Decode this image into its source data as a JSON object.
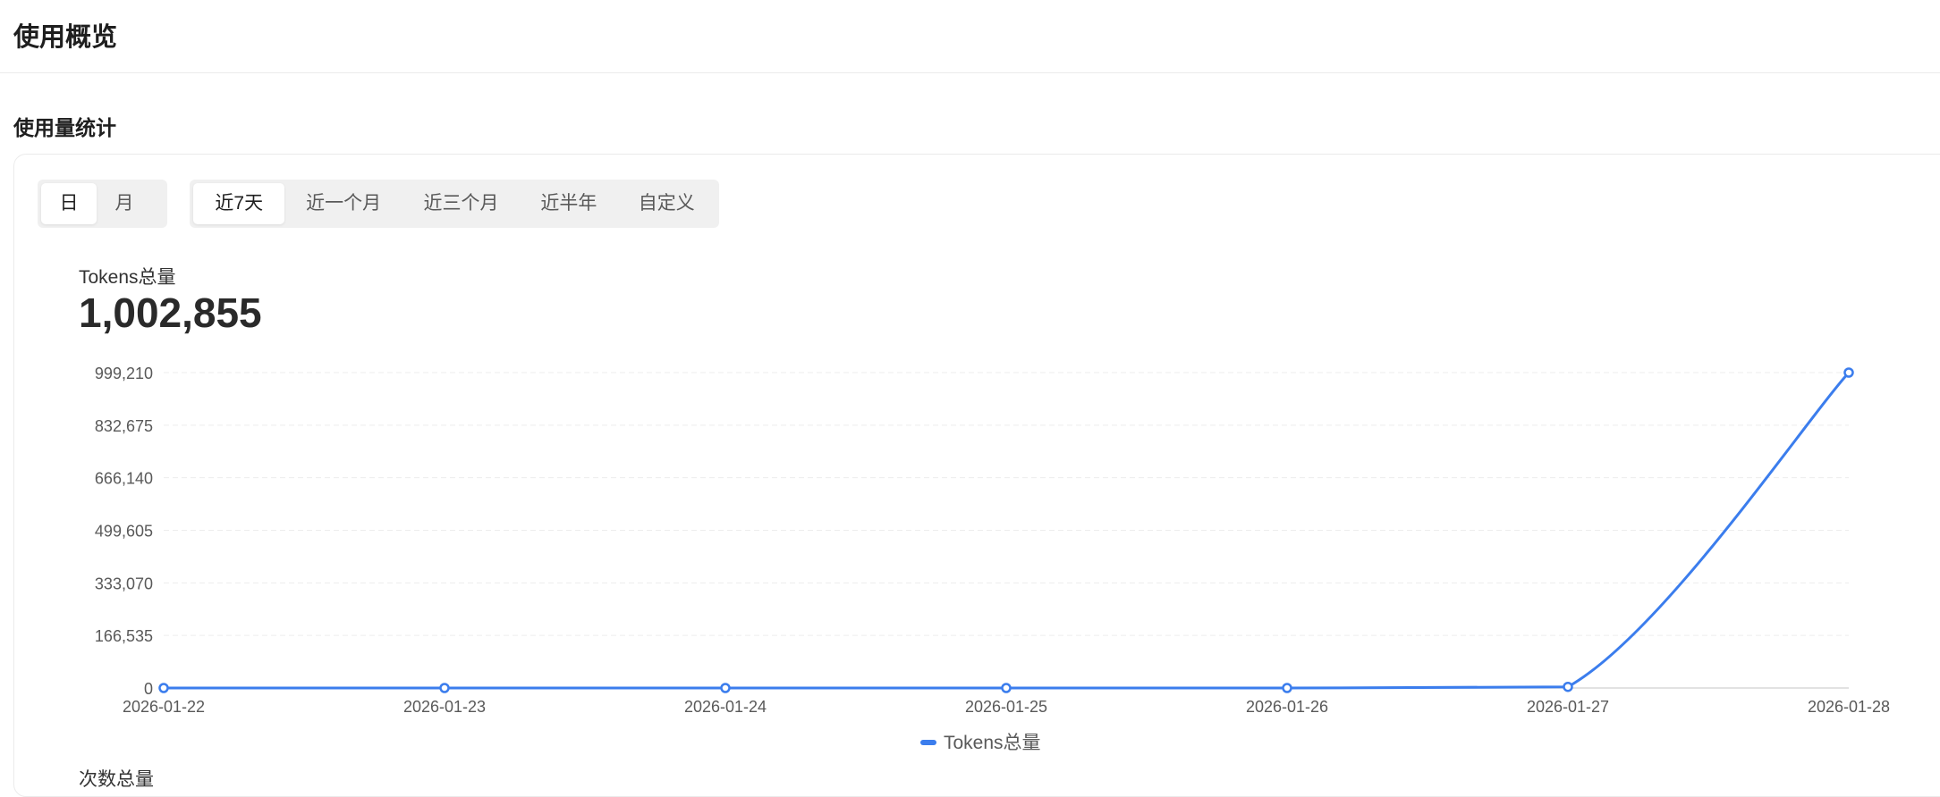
{
  "page": {
    "title": "使用概览"
  },
  "section": {
    "title": "使用量统计"
  },
  "granularity": {
    "options": [
      "日",
      "月"
    ],
    "selected": "日"
  },
  "range": {
    "options": [
      "近7天",
      "近一个月",
      "近三个月",
      "近半年",
      "自定义"
    ],
    "selected": "近7天"
  },
  "metric": {
    "label": "Tokens总量",
    "value": "1,002,855"
  },
  "next_metric": {
    "label": "次数总量"
  },
  "colors": {
    "accent": "#3b7ded",
    "grid": "#ededed",
    "axis_text": "#595959"
  },
  "chart_data": {
    "type": "line",
    "x": [
      "2026-01-22",
      "2026-01-23",
      "2026-01-24",
      "2026-01-25",
      "2026-01-26",
      "2026-01-27",
      "2026-01-28"
    ],
    "series": [
      {
        "name": "Tokens总量",
        "values": [
          0,
          0,
          0,
          0,
          0,
          3645,
          999210
        ]
      }
    ],
    "y_ticks": [
      "0",
      "166,535",
      "333,070",
      "499,605",
      "666,140",
      "832,675",
      "999,210"
    ],
    "ylim": [
      0,
      999210
    ],
    "grid": true,
    "legend": "bottom-center",
    "smooth": true
  }
}
